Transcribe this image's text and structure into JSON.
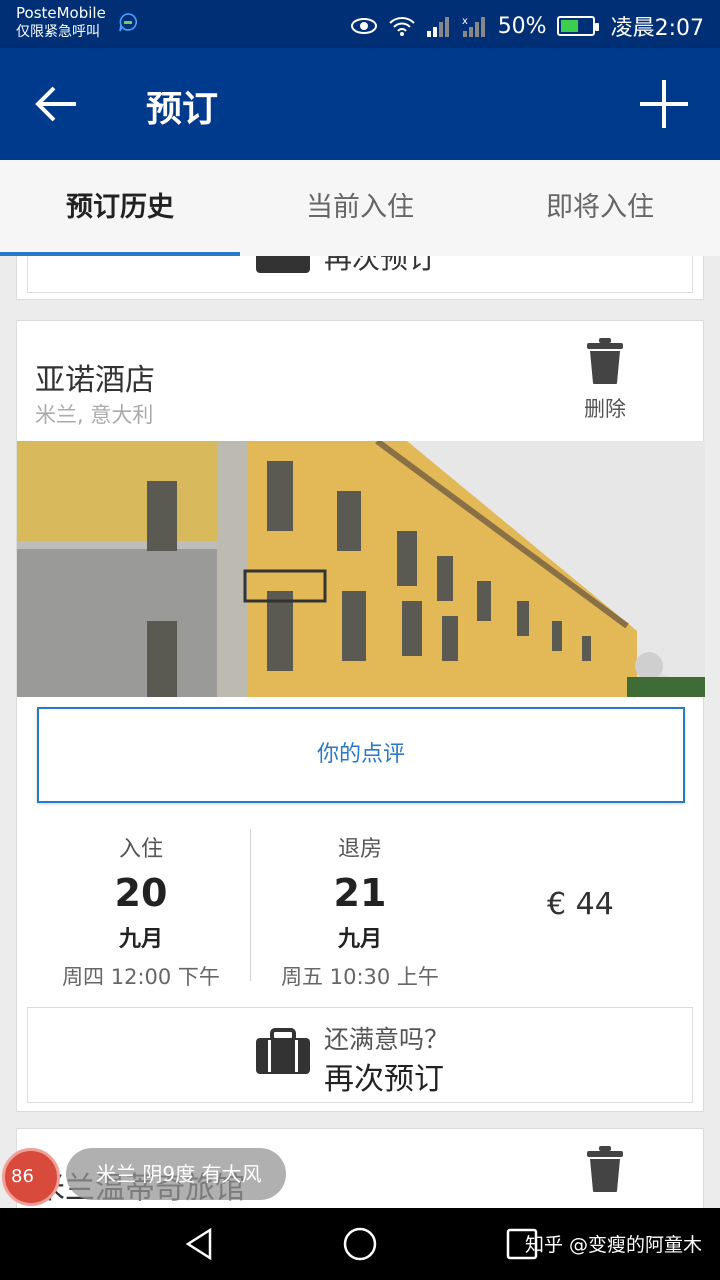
{
  "status_bar": {
    "carrier": "PosteMobile",
    "carrier_sub": "仅限紧急呼叫",
    "battery": "50%",
    "time": "凌晨2:07",
    "icons": [
      "chat-notification-icon",
      "eye-icon",
      "wifi-icon",
      "signal-icon",
      "signal-x-icon",
      "battery-icon"
    ]
  },
  "appbar": {
    "title": "预订",
    "back_icon": "arrow-left-icon",
    "add_icon": "plus-icon"
  },
  "tabs": [
    {
      "label": "预订历史",
      "active": true
    },
    {
      "label": "当前入住",
      "active": false
    },
    {
      "label": "即将入住",
      "active": false
    }
  ],
  "top_card": {
    "rebook_label": "再次预订"
  },
  "booking": {
    "hotel_name": "亚诺酒店",
    "location": "米兰, 意大利",
    "delete_label": "删除",
    "review_label": "你的点评",
    "checkin": {
      "header": "入住",
      "day": "20",
      "month": "九月",
      "time": "周四 12:00 下午"
    },
    "checkout": {
      "header": "退房",
      "day": "21",
      "month": "九月",
      "time": "周五 10:30 上午"
    },
    "price": "€ 44",
    "rebook_question": "还满意吗？",
    "rebook_label": "再次预订"
  },
  "next_booking": {
    "hotel_name": "米兰温蒂奇旅馆"
  },
  "weather_overlay": {
    "badge": "86",
    "text": "米兰 阴9度 有大风"
  },
  "watermark": "知乎 @变瘦的阿童木",
  "colors": {
    "status_bar": "#002f75",
    "app_bar": "#003a8c",
    "accent": "#2a79c6"
  }
}
